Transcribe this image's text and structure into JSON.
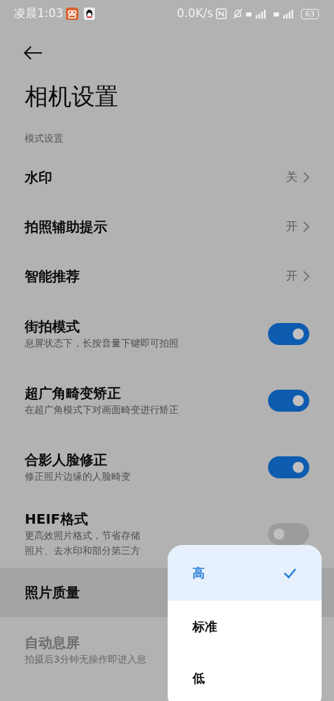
{
  "status_bar": {
    "time": "凌晨1:03",
    "network_speed": "0.0K/s",
    "battery": "63"
  },
  "title": "相机设置",
  "section": "模式设置",
  "rows": [
    {
      "kind": "value",
      "label": "水印",
      "value": "关"
    },
    {
      "kind": "value",
      "label": "拍照辅助提示",
      "value": "开"
    },
    {
      "kind": "value",
      "label": "智能推荐",
      "value": "开"
    },
    {
      "kind": "toggle",
      "label": "街拍模式",
      "desc_lines": [
        "息屏状态下，长按音量下键即可拍照"
      ],
      "on": true
    },
    {
      "kind": "toggle",
      "label": "超广角畸变矫正",
      "desc_lines": [
        "在超广角模式下对画面畸变进行矫正"
      ],
      "on": true
    },
    {
      "kind": "toggle",
      "label": "合影人脸修正",
      "desc_lines": [
        "修正照片边缘的人脸畸变"
      ],
      "on": true
    },
    {
      "kind": "toggle",
      "label": "HEIF格式",
      "desc_lines": [
        "更高效照片格式，节省存储",
        "照片、去水印和部分第三方"
      ],
      "on": false
    },
    {
      "kind": "menu",
      "label": "照片质量",
      "selected": true
    },
    {
      "kind": "toggle",
      "label": "自动息屏",
      "desc_lines": [
        "拍摄后3分钟无操作即进入息"
      ],
      "disabled": true
    }
  ],
  "menu": [
    {
      "label": "高",
      "selected": true
    },
    {
      "label": "标准",
      "selected": false
    },
    {
      "label": "低",
      "selected": false
    }
  ]
}
